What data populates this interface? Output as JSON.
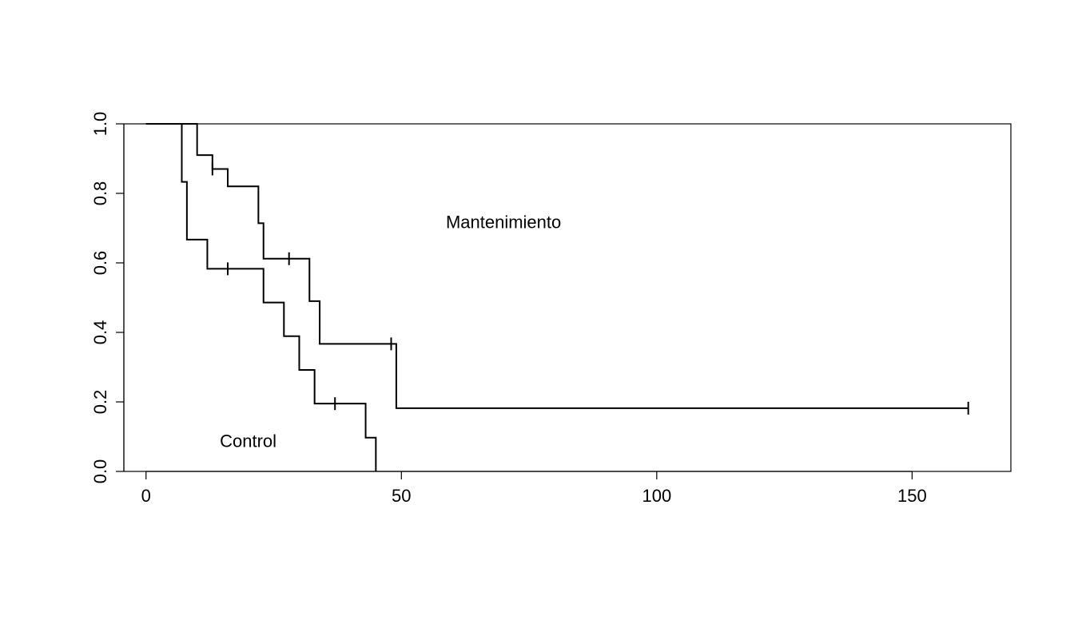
{
  "chart_data": {
    "type": "line",
    "title": "",
    "xlabel": "",
    "ylabel": "",
    "xlim": [
      0,
      165
    ],
    "ylim": [
      0.0,
      1.0
    ],
    "x_ticks": [
      0,
      50,
      100,
      150
    ],
    "y_ticks": [
      0.0,
      0.2,
      0.4,
      0.6,
      0.8,
      1.0
    ],
    "series": [
      {
        "name": "Mantenimiento",
        "type": "step",
        "x": [
          0,
          6,
          10,
          13,
          16,
          22,
          23,
          28,
          32,
          34,
          48,
          49,
          50,
          161
        ],
        "y": [
          1.0,
          1.0,
          0.91,
          0.87,
          0.82,
          0.714,
          0.612,
          0.612,
          0.49,
          0.367,
          0.367,
          0.182,
          0.182,
          0.182
        ],
        "censor_marks": [
          {
            "x": 13,
            "y": 0.87
          },
          {
            "x": 28,
            "y": 0.612
          },
          {
            "x": 48,
            "y": 0.367
          },
          {
            "x": 161,
            "y": 0.182
          }
        ]
      },
      {
        "name": "Control",
        "type": "step",
        "x": [
          0,
          5,
          7,
          8,
          12,
          16,
          23,
          27,
          30,
          33,
          37,
          43,
          45
        ],
        "y": [
          1.0,
          1.0,
          0.833,
          0.667,
          0.583,
          0.583,
          0.486,
          0.389,
          0.292,
          0.195,
          0.195,
          0.097,
          0.0
        ],
        "censor_marks": [
          {
            "x": 16,
            "y": 0.583
          },
          {
            "x": 37,
            "y": 0.195
          }
        ]
      }
    ],
    "annotations": [
      {
        "text": "Mantenimiento",
        "x": 70,
        "y": 0.7
      },
      {
        "text": "Control",
        "x": 20,
        "y": 0.07
      }
    ],
    "y_tick_labels": {
      "t0": "0.0",
      "t1": "0.2",
      "t2": "0.4",
      "t3": "0.6",
      "t4": "0.8",
      "t5": "1.0"
    },
    "x_tick_labels": {
      "t0": "0",
      "t1": "50",
      "t2": "100",
      "t3": "150"
    },
    "labels": {
      "series1": "Mantenimiento",
      "series2": "Control"
    }
  }
}
